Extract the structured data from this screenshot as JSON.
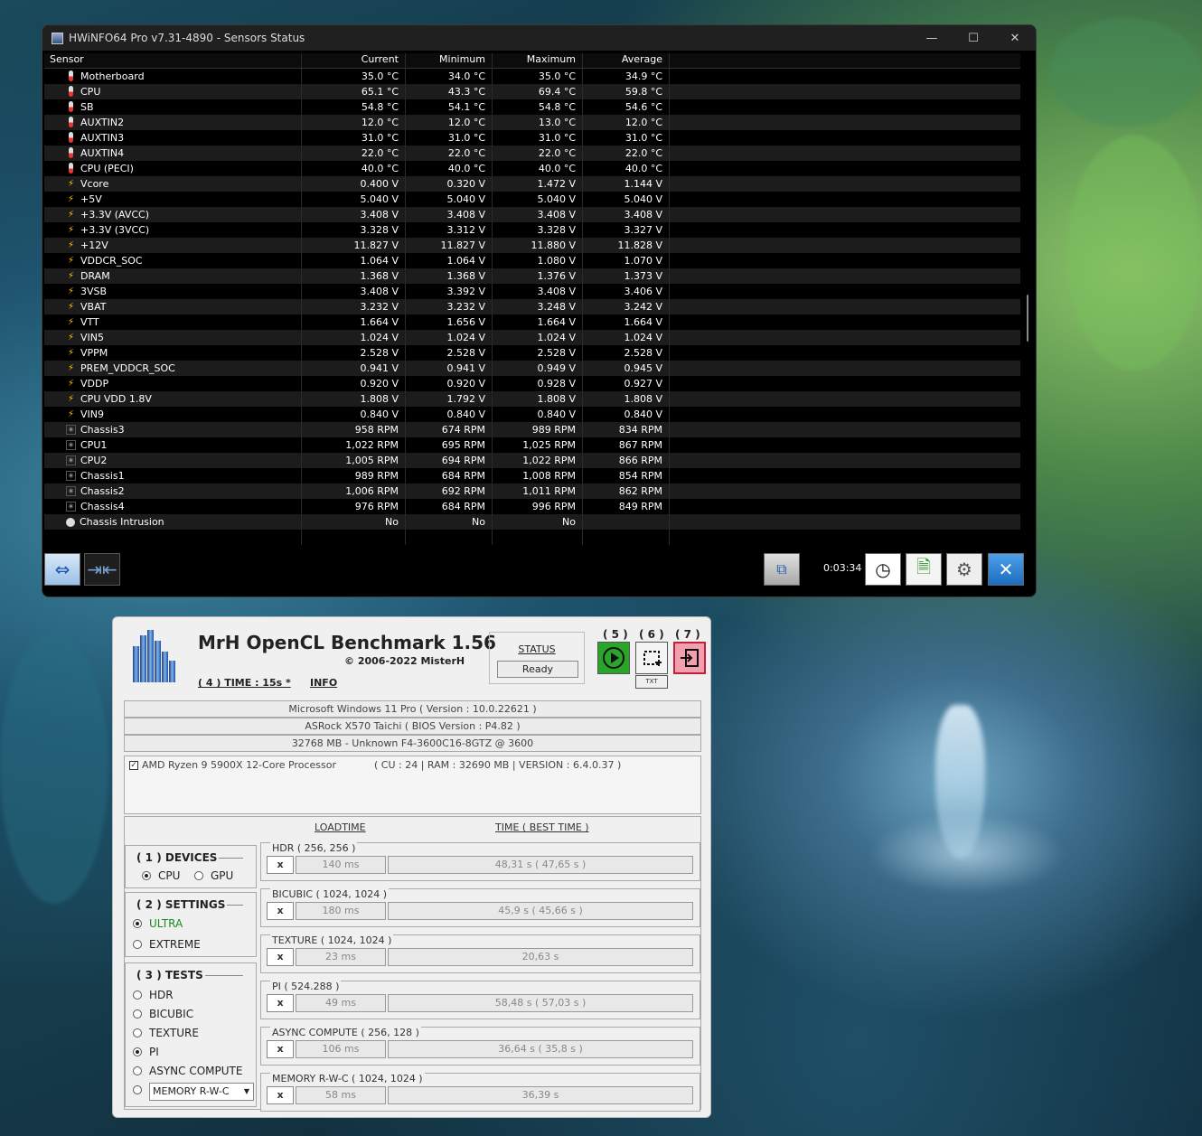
{
  "hwinfo": {
    "title": "HWiNFO64 Pro v7.31-4890 - Sensors Status",
    "columns": [
      "Sensor",
      "Current",
      "Minimum",
      "Maximum",
      "Average"
    ],
    "rows": [
      {
        "icon": "temp",
        "name": "Motherboard",
        "cur": "35.0 °C",
        "min": "34.0 °C",
        "max": "35.0 °C",
        "avg": "34.9 °C"
      },
      {
        "icon": "temp",
        "name": "CPU",
        "cur": "65.1 °C",
        "min": "43.3 °C",
        "max": "69.4 °C",
        "avg": "59.8 °C"
      },
      {
        "icon": "temp",
        "name": "SB",
        "cur": "54.8 °C",
        "min": "54.1 °C",
        "max": "54.8 °C",
        "avg": "54.6 °C"
      },
      {
        "icon": "temp",
        "name": "AUXTIN2",
        "cur": "12.0 °C",
        "min": "12.0 °C",
        "max": "13.0 °C",
        "avg": "12.0 °C"
      },
      {
        "icon": "temp",
        "name": "AUXTIN3",
        "cur": "31.0 °C",
        "min": "31.0 °C",
        "max": "31.0 °C",
        "avg": "31.0 °C"
      },
      {
        "icon": "temp",
        "name": "AUXTIN4",
        "cur": "22.0 °C",
        "min": "22.0 °C",
        "max": "22.0 °C",
        "avg": "22.0 °C"
      },
      {
        "icon": "temp",
        "name": "CPU (PECI)",
        "cur": "40.0 °C",
        "min": "40.0 °C",
        "max": "40.0 °C",
        "avg": "40.0 °C"
      },
      {
        "icon": "volt",
        "name": "Vcore",
        "cur": "0.400 V",
        "min": "0.320 V",
        "max": "1.472 V",
        "avg": "1.144 V"
      },
      {
        "icon": "volt",
        "name": "+5V",
        "cur": "5.040 V",
        "min": "5.040 V",
        "max": "5.040 V",
        "avg": "5.040 V"
      },
      {
        "icon": "volt",
        "name": "+3.3V (AVCC)",
        "cur": "3.408 V",
        "min": "3.408 V",
        "max": "3.408 V",
        "avg": "3.408 V"
      },
      {
        "icon": "volt",
        "name": "+3.3V (3VCC)",
        "cur": "3.328 V",
        "min": "3.312 V",
        "max": "3.328 V",
        "avg": "3.327 V"
      },
      {
        "icon": "volt",
        "name": "+12V",
        "cur": "11.827 V",
        "min": "11.827 V",
        "max": "11.880 V",
        "avg": "11.828 V"
      },
      {
        "icon": "volt",
        "name": "VDDCR_SOC",
        "cur": "1.064 V",
        "min": "1.064 V",
        "max": "1.080 V",
        "avg": "1.070 V"
      },
      {
        "icon": "volt",
        "name": "DRAM",
        "cur": "1.368 V",
        "min": "1.368 V",
        "max": "1.376 V",
        "avg": "1.373 V"
      },
      {
        "icon": "volt",
        "name": "3VSB",
        "cur": "3.408 V",
        "min": "3.392 V",
        "max": "3.408 V",
        "avg": "3.406 V"
      },
      {
        "icon": "volt",
        "name": "VBAT",
        "cur": "3.232 V",
        "min": "3.232 V",
        "max": "3.248 V",
        "avg": "3.242 V"
      },
      {
        "icon": "volt",
        "name": "VTT",
        "cur": "1.664 V",
        "min": "1.656 V",
        "max": "1.664 V",
        "avg": "1.664 V"
      },
      {
        "icon": "volt",
        "name": "VIN5",
        "cur": "1.024 V",
        "min": "1.024 V",
        "max": "1.024 V",
        "avg": "1.024 V"
      },
      {
        "icon": "volt",
        "name": "VPPM",
        "cur": "2.528 V",
        "min": "2.528 V",
        "max": "2.528 V",
        "avg": "2.528 V"
      },
      {
        "icon": "volt",
        "name": "PREM_VDDCR_SOC",
        "cur": "0.941 V",
        "min": "0.941 V",
        "max": "0.949 V",
        "avg": "0.945 V"
      },
      {
        "icon": "volt",
        "name": "VDDP",
        "cur": "0.920 V",
        "min": "0.920 V",
        "max": "0.928 V",
        "avg": "0.927 V"
      },
      {
        "icon": "volt",
        "name": "CPU VDD 1.8V",
        "cur": "1.808 V",
        "min": "1.792 V",
        "max": "1.808 V",
        "avg": "1.808 V"
      },
      {
        "icon": "volt",
        "name": "VIN9",
        "cur": "0.840 V",
        "min": "0.840 V",
        "max": "0.840 V",
        "avg": "0.840 V"
      },
      {
        "icon": "fan",
        "name": "Chassis3",
        "cur": "958 RPM",
        "min": "674 RPM",
        "max": "989 RPM",
        "avg": "834 RPM"
      },
      {
        "icon": "fan",
        "name": "CPU1",
        "cur": "1,022 RPM",
        "min": "695 RPM",
        "max": "1,025 RPM",
        "avg": "867 RPM"
      },
      {
        "icon": "fan",
        "name": "CPU2",
        "cur": "1,005 RPM",
        "min": "694 RPM",
        "max": "1,022 RPM",
        "avg": "866 RPM"
      },
      {
        "icon": "fan",
        "name": "Chassis1",
        "cur": "989 RPM",
        "min": "684 RPM",
        "max": "1,008 RPM",
        "avg": "854 RPM"
      },
      {
        "icon": "fan",
        "name": "Chassis2",
        "cur": "1,006 RPM",
        "min": "692 RPM",
        "max": "1,011 RPM",
        "avg": "862 RPM"
      },
      {
        "icon": "fan",
        "name": "Chassis4",
        "cur": "976 RPM",
        "min": "684 RPM",
        "max": "996 RPM",
        "avg": "849 RPM"
      },
      {
        "icon": "intr",
        "name": "Chassis Intrusion",
        "cur": "No",
        "min": "No",
        "max": "No",
        "avg": ""
      }
    ],
    "elapsed": "0:03:34"
  },
  "mrh": {
    "title": "MrH OpenCL Benchmark 1.56",
    "copyright": "© 2006-2022 MisterH",
    "time_link": "( 4 ) TIME : 15s *",
    "info_link": "INFO",
    "status_label": "STATUS",
    "status_value": "Ready",
    "btn5": "( 5 )",
    "btn6": "( 6 )",
    "btn7": "( 7 )",
    "txt_label": "TXT",
    "os": "Microsoft Windows 11 Pro ( Version : 10.0.22621 )",
    "board": "ASRock X570 Taichi ( BIOS Version : P4.82 )",
    "memory": "32768 MB - Unknown F4-3600C16-8GTZ @ 3600",
    "cpu_name": "AMD Ryzen 9 5900X 12-Core Processor",
    "cpu_info": "( CU : 24 | RAM : 32690 MB | VERSION : 6.4.0.37 )",
    "loadtime_hdr": "LOADTIME",
    "time_hdr": "TIME ( BEST TIME )",
    "devices_title": "( 1 ) DEVICES",
    "dev_cpu": "CPU",
    "dev_gpu": "GPU",
    "settings_title": "( 2 ) SETTINGS",
    "set_ultra": "ULTRA",
    "set_extreme": "EXTREME",
    "tests_title": "( 3 ) TESTS",
    "tests": [
      "HDR",
      "BICUBIC",
      "TEXTURE",
      "PI",
      "ASYNC COMPUTE"
    ],
    "tests_select": "MEMORY R-W-C",
    "results": [
      {
        "name": "HDR ( 256, 256 )",
        "x": "x",
        "load": "140 ms",
        "time": "48,31 s ( 47,65 s )"
      },
      {
        "name": "BICUBIC ( 1024, 1024 )",
        "x": "x",
        "load": "180 ms",
        "time": "45,9 s ( 45,66 s )"
      },
      {
        "name": "TEXTURE ( 1024, 1024 )",
        "x": "x",
        "load": "23 ms",
        "time": "20,63 s"
      },
      {
        "name": "PI ( 524.288 )",
        "x": "x",
        "load": "49 ms",
        "time": "58,48 s ( 57,03 s )"
      },
      {
        "name": "ASYNC COMPUTE ( 256, 128 )",
        "x": "x",
        "load": "106 ms",
        "time": "36,64 s ( 35,8 s )"
      },
      {
        "name": "MEMORY R-W-C ( 1024, 1024 )",
        "x": "x",
        "load": "58 ms",
        "time": "36,39 s"
      }
    ]
  },
  "colors": {
    "ultra": "#1a8a1a",
    "run_green": "#2aa52a",
    "exit_pink": "#f2a0b0"
  }
}
